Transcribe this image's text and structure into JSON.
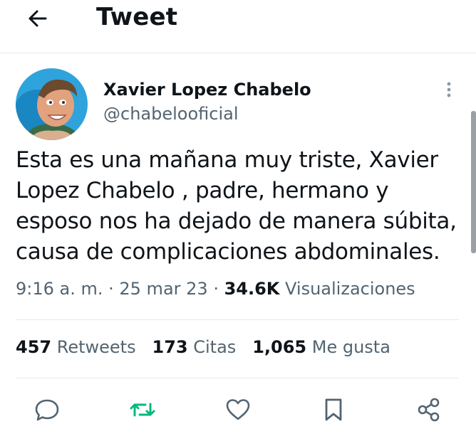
{
  "header": {
    "title": "Tweet",
    "back_icon": "arrow-left-icon"
  },
  "author": {
    "name": "Xavier Lopez Chabelo",
    "handle": "@chabelooficial",
    "avatar": "avatar-photo"
  },
  "tweet": {
    "text": "Esta es una mañana muy triste,  Xavier\nLopez Chabelo , padre, hermano y\nesposo nos ha dejado de manera súbita,\ncausa de complicaciones abdominales.",
    "time": "9:16 a. m.",
    "sep1": " · ",
    "date": "25 mar 23",
    "sep2": " · ",
    "views_count": "34.6K",
    "views_label": "Visualizaciones"
  },
  "stats": {
    "retweets_count": "457",
    "retweets_label": "Retweets",
    "quotes_count": "173",
    "quotes_label": "Citas",
    "likes_count": "1,065",
    "likes_label": "Me gusta"
  },
  "actions": [
    "reply-icon",
    "retweet-icon",
    "like-icon",
    "bookmark-icon",
    "share-icon"
  ],
  "colors": {
    "retweet_active": "#00ba7c",
    "secondary_text": "#536471",
    "primary_text": "#0f1419"
  }
}
